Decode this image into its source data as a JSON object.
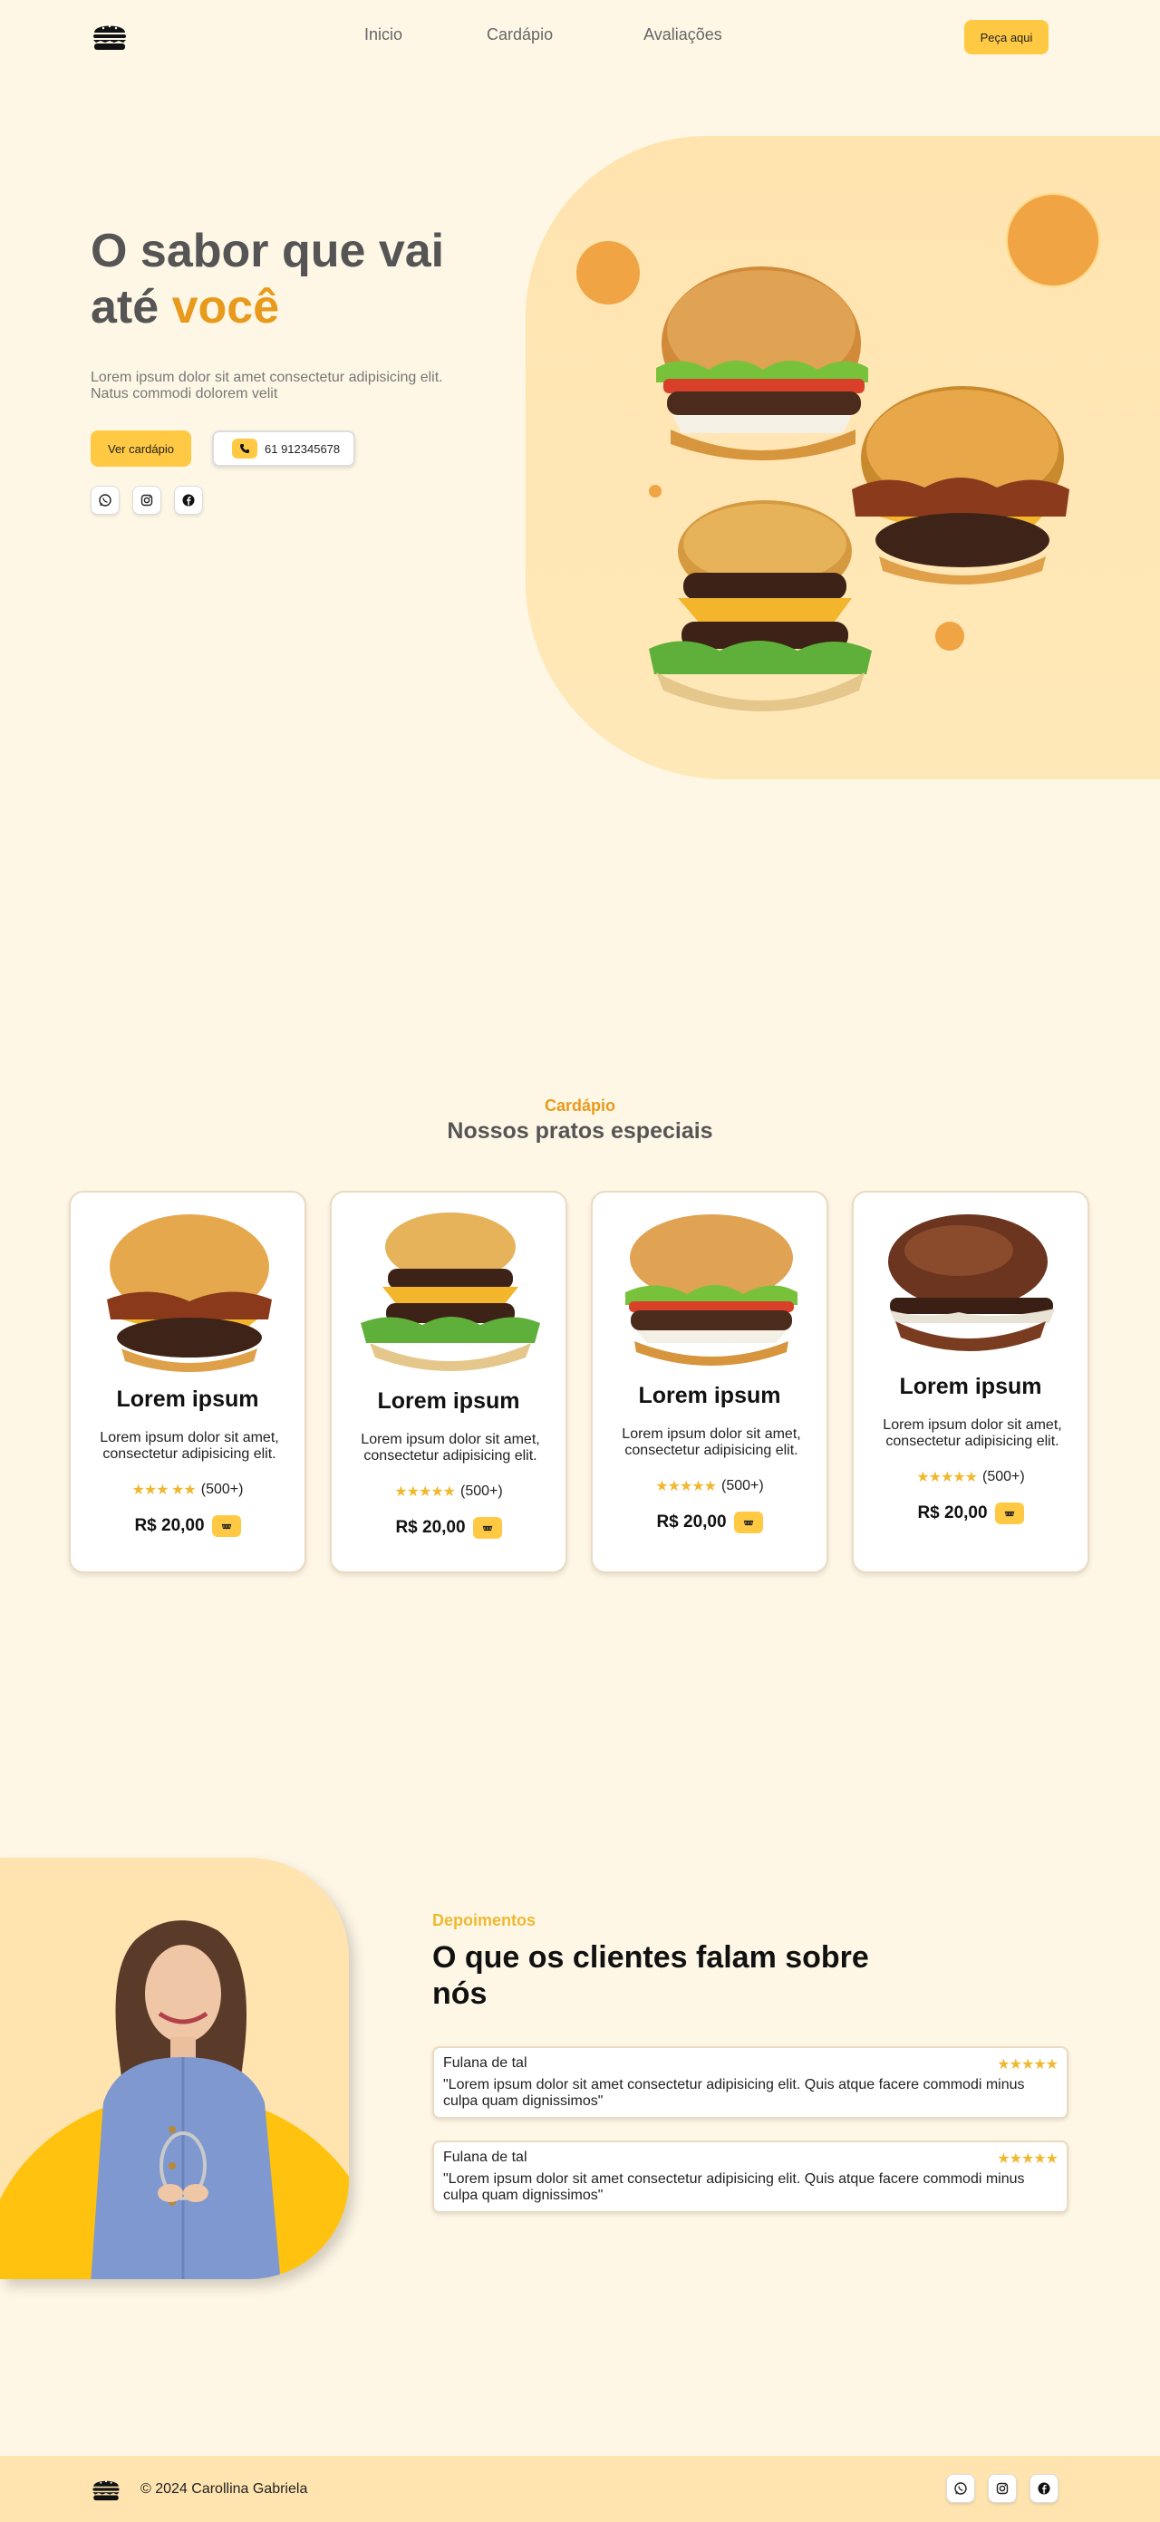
{
  "header": {
    "nav": [
      "Inicio",
      "Cardápio",
      "Avaliações"
    ],
    "cta": "Peça aqui"
  },
  "hero": {
    "title_line1": "O sabor que vai",
    "title_line2_prefix": "até ",
    "title_line2_accent": "você",
    "description": "Lorem ipsum dolor sit amet consectetur adipisicing elit. Natus commodi dolorem velit",
    "menu_button": "Ver cardápio",
    "phone": "61 912345678"
  },
  "menu": {
    "eyebrow": "Cardápio",
    "title": "Nossos pratos especiais",
    "cards": [
      {
        "name": "Lorem ipsum",
        "desc": "Lorem ipsum dolor sit amet, consectetur adipisicing elit.",
        "stars": "★★★ ★★",
        "count": "(500+)",
        "price": "R$ 20,00"
      },
      {
        "name": "Lorem ipsum",
        "desc": "Lorem ipsum dolor sit amet, consectetur adipisicing elit.",
        "stars": "★★★★★",
        "count": "(500+)",
        "price": "R$ 20,00"
      },
      {
        "name": "Lorem ipsum",
        "desc": "Lorem ipsum dolor sit amet, consectetur adipisicing elit.",
        "stars": "★★★★★",
        "count": "(500+)",
        "price": "R$ 20,00"
      },
      {
        "name": "Lorem ipsum",
        "desc": "Lorem ipsum dolor sit amet, consectetur adipisicing elit.",
        "stars": "★★★★★",
        "count": "(500+)",
        "price": "R$ 20,00"
      }
    ]
  },
  "testimonials": {
    "eyebrow": "Depoimentos",
    "title": "O que os clientes falam sobre nós",
    "reviews": [
      {
        "name": "Fulana de tal",
        "stars": "★★★★★",
        "text": "\"Lorem ipsum dolor sit amet consectetur adipisicing elit. Quis atque facere commodi minus culpa quam dignissimos\""
      },
      {
        "name": "Fulana de tal",
        "stars": "★★★★★",
        "text": "\"Lorem ipsum dolor sit amet consectetur adipisicing elit. Quis atque facere commodi minus culpa quam dignissimos\""
      }
    ]
  },
  "footer": {
    "copyright": "© 2024 Carollina Gabriela"
  },
  "colors": {
    "background": "#fff7e6",
    "accent_yellow": "#ffc944",
    "accent_orange": "#e89a1c",
    "soft_shape": "#ffe4b0"
  },
  "icons": [
    "burger-logo-icon",
    "whatsapp-icon",
    "instagram-icon",
    "facebook-icon",
    "phone-icon",
    "cart-icon",
    "star-icon"
  ]
}
